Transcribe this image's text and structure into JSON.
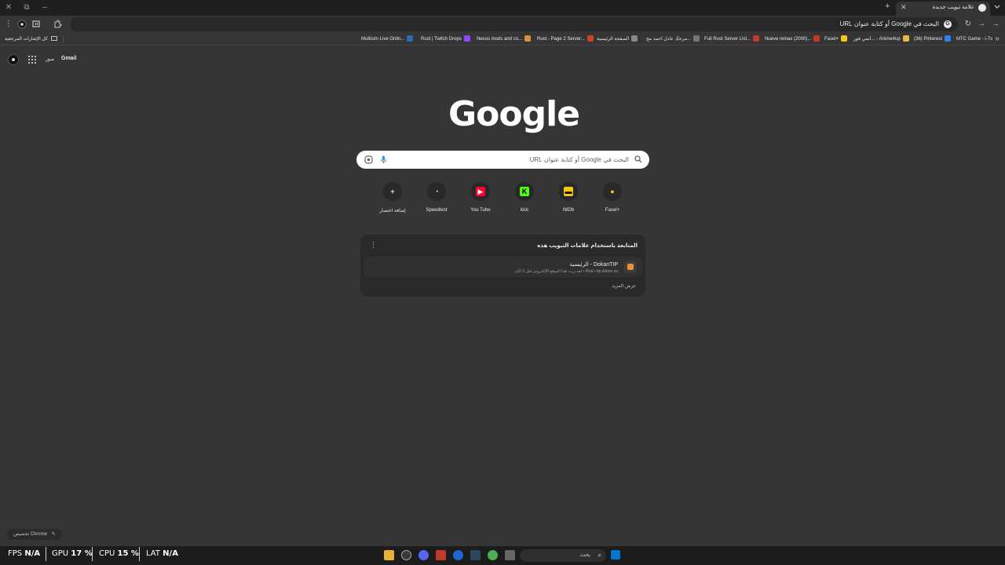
{
  "tabstrip": {
    "active_tab_title": "علامة تبويب جديدة",
    "close_glyph": "✕",
    "new_tab_glyph": "+"
  },
  "toolbar": {
    "omnibox_text": "البحث في Google أو كتابة عنوان URL"
  },
  "bookmarks": {
    "all_bookmarks": "كل الإشارات المرجعية",
    "items": [
      {
        "label": "Multisim Live Onlin...",
        "color": "#2b6cb0"
      },
      {
        "label": "Rust | Twitch Drops",
        "color": "#9146ff"
      },
      {
        "label": "Nexus mods and co...",
        "color": "#d98f40"
      },
      {
        "label": "Rust - Page 2 Server...",
        "color": "#cd412b"
      },
      {
        "label": "الصفحة الرئيسية",
        "color": "#888888"
      },
      {
        "label": "مرحبًا, عادل احمد مج...",
        "color": "#777777"
      },
      {
        "label": "Full Rust Server List...",
        "color": "#c0392b"
      },
      {
        "label": "Nueve reinas (2000)...",
        "color": "#c0392b"
      },
      {
        "label": "Fasel+",
        "color": "#f5c518"
      },
      {
        "label": "انمي فور... - Anime4up",
        "color": "#e9b949"
      },
      {
        "label": "(36) Pinterest",
        "color": "#2f80ed"
      },
      {
        "label": "MTC Game - i-7s",
        "color": "#e60023"
      }
    ]
  },
  "google_links": {
    "images": "صور",
    "gmail": "Gmail"
  },
  "logo": "Google",
  "search": {
    "placeholder": "البحث في Google أو كتابة عنوان URL"
  },
  "shortcuts": [
    {
      "label": "إضافة اختصار",
      "icon": "plus-icon",
      "glyph": "+",
      "color": "#e8eaed",
      "bg": "transparent"
    },
    {
      "label": "Speedtest",
      "icon": "speedtest-icon",
      "glyph": "◔",
      "color": "#e8eaed",
      "bg": "transparent"
    },
    {
      "label": "You Tube",
      "icon": "youtube-icon",
      "glyph": "▶",
      "color": "#ffffff",
      "bg": "#ff0033"
    },
    {
      "label": "kick",
      "icon": "kick-icon",
      "glyph": "K",
      "color": "#000000",
      "bg": "#53fc18"
    },
    {
      "label": "IMDb",
      "icon": "imdb-icon",
      "glyph": "▬",
      "color": "#000000",
      "bg": "#f5c518"
    },
    {
      "label": "Fasel+",
      "icon": "fasel-icon",
      "glyph": "●",
      "color": "#f5c518",
      "bg": "transparent"
    }
  ],
  "journey_card": {
    "title": "المتابعة باستخدام علامات التبويب هذه",
    "menu_glyph": "⋮",
    "item_title": "DokanTIP - الرئيسية",
    "item_subtitle": "iPad • tip.dokan.sa • لقد زرت هذا الموقع الإلكتروني قبل 3 أيام",
    "more": "عرض المزيد"
  },
  "customize": {
    "label": "تخصيص Chrome",
    "glyph": "✎"
  },
  "overlay": {
    "fps_label": "FPS",
    "fps_value": "N/A",
    "gpu_label": "GPU",
    "gpu_value": "17 %",
    "cpu_label": "CPU",
    "cpu_value": "15 %",
    "lat_label": "LAT",
    "lat_value": "N/A"
  },
  "taskbar": {
    "search_text": "بحث"
  }
}
